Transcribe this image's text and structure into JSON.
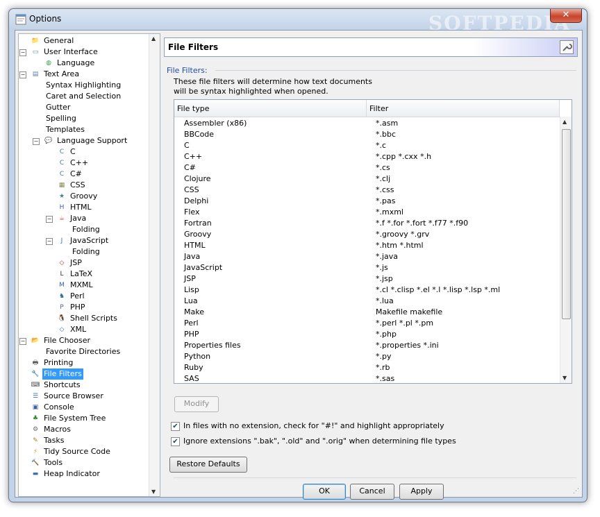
{
  "window": {
    "title": "Options",
    "close_symbol": "✕",
    "watermark": "SOFTPEDIA"
  },
  "tree": [
    {
      "label": "General",
      "level": 1,
      "icon": "folder-icon",
      "glyph": "📁",
      "color": "#e6b94d",
      "expander": ""
    },
    {
      "label": "User Interface",
      "level": 1,
      "icon": "window-icon",
      "glyph": "▭",
      "color": "#5a7fb0",
      "expander": "−"
    },
    {
      "label": "Language",
      "level": 2,
      "icon": "globe-icon",
      "glyph": "◍",
      "color": "#3a9a4a",
      "expander": ""
    },
    {
      "label": "Text Area",
      "level": 1,
      "icon": "text-area-icon",
      "glyph": "▤",
      "color": "#5a7fb0",
      "expander": "−"
    },
    {
      "label": "Syntax Highlighting",
      "level": 2,
      "icon": "",
      "glyph": "",
      "color": "",
      "expander": ""
    },
    {
      "label": "Caret and Selection",
      "level": 2,
      "icon": "",
      "glyph": "",
      "color": "",
      "expander": ""
    },
    {
      "label": "Gutter",
      "level": 2,
      "icon": "",
      "glyph": "",
      "color": "",
      "expander": ""
    },
    {
      "label": "Spelling",
      "level": 2,
      "icon": "",
      "glyph": "",
      "color": "",
      "expander": ""
    },
    {
      "label": "Templates",
      "level": 2,
      "icon": "",
      "glyph": "",
      "color": "",
      "expander": ""
    },
    {
      "label": "Language Support",
      "level": 2,
      "icon": "speech-bubble-icon",
      "glyph": "💬",
      "color": "#5a7fb0",
      "expander": "−"
    },
    {
      "label": "C",
      "level": 3,
      "icon": "c-language-icon",
      "glyph": "C",
      "color": "#4b6fb5",
      "expander": ""
    },
    {
      "label": "C++",
      "level": 3,
      "icon": "cpp-language-icon",
      "glyph": "C",
      "color": "#4b6fb5",
      "expander": ""
    },
    {
      "label": "C#",
      "level": 3,
      "icon": "csharp-language-icon",
      "glyph": "C",
      "color": "#4b6fb5",
      "expander": ""
    },
    {
      "label": "CSS",
      "level": 3,
      "icon": "css-icon",
      "glyph": "▦",
      "color": "#8a8a5a",
      "expander": ""
    },
    {
      "label": "Groovy",
      "level": 3,
      "icon": "groovy-icon",
      "glyph": "★",
      "color": "#4a7a9a",
      "expander": ""
    },
    {
      "label": "HTML",
      "level": 3,
      "icon": "html-icon",
      "glyph": "H",
      "color": "#3a5fa0",
      "expander": ""
    },
    {
      "label": "Java",
      "level": 3,
      "icon": "java-cup-icon",
      "glyph": "☕",
      "color": "#b35a2a",
      "expander": "−"
    },
    {
      "label": "Folding",
      "level": 4,
      "icon": "",
      "glyph": "",
      "color": "",
      "expander": ""
    },
    {
      "label": "JavaScript",
      "level": 3,
      "icon": "javascript-icon",
      "glyph": "J",
      "color": "#3a70c0",
      "expander": "−"
    },
    {
      "label": "Folding",
      "level": 4,
      "icon": "",
      "glyph": "",
      "color": "",
      "expander": ""
    },
    {
      "label": "JSP",
      "level": 3,
      "icon": "jsp-icon",
      "glyph": "◇",
      "color": "#c03030",
      "expander": ""
    },
    {
      "label": "LaTeX",
      "level": 3,
      "icon": "latex-icon",
      "glyph": "L",
      "color": "#333333",
      "expander": ""
    },
    {
      "label": "MXML",
      "level": 3,
      "icon": "mxml-icon",
      "glyph": "M",
      "color": "#3a5fa0",
      "expander": ""
    },
    {
      "label": "Perl",
      "level": 3,
      "icon": "perl-camel-icon",
      "glyph": "♞",
      "color": "#2a6a8a",
      "expander": ""
    },
    {
      "label": "PHP",
      "level": 3,
      "icon": "php-icon",
      "glyph": "P",
      "color": "#5b5fa0",
      "expander": ""
    },
    {
      "label": "Shell Scripts",
      "level": 3,
      "icon": "penguin-icon",
      "glyph": "🐧",
      "color": "#222222",
      "expander": ""
    },
    {
      "label": "XML",
      "level": 3,
      "icon": "xml-icon",
      "glyph": "◇",
      "color": "#3a70c0",
      "expander": ""
    },
    {
      "label": "File Chooser",
      "level": 1,
      "icon": "folder-open-icon",
      "glyph": "📂",
      "color": "#e6b94d",
      "expander": "−"
    },
    {
      "label": "Favorite Directories",
      "level": 2,
      "icon": "",
      "glyph": "",
      "color": "",
      "expander": ""
    },
    {
      "label": "Printing",
      "level": 1,
      "icon": "printer-icon",
      "glyph": "🖶",
      "color": "#555555",
      "expander": ""
    },
    {
      "label": "File Filters",
      "level": 1,
      "icon": "wrench-icon",
      "glyph": "🔧",
      "color": "#777777",
      "expander": "",
      "selected": true
    },
    {
      "label": "Shortcuts",
      "level": 1,
      "icon": "keyboard-icon",
      "glyph": "⌨",
      "color": "#555555",
      "expander": ""
    },
    {
      "label": "Source Browser",
      "level": 1,
      "icon": "list-icon",
      "glyph": "☰",
      "color": "#3a70c0",
      "expander": ""
    },
    {
      "label": "Console",
      "level": 1,
      "icon": "monitor-icon",
      "glyph": "▣",
      "color": "#3a5fa0",
      "expander": ""
    },
    {
      "label": "File System Tree",
      "level": 1,
      "icon": "tree-icon",
      "glyph": "♣",
      "color": "#2a8a2a",
      "expander": ""
    },
    {
      "label": "Macros",
      "level": 1,
      "icon": "gear-icon",
      "glyph": "⚙",
      "color": "#666666",
      "expander": ""
    },
    {
      "label": "Tasks",
      "level": 1,
      "icon": "pencil-icon",
      "glyph": "✎",
      "color": "#b07a20",
      "expander": ""
    },
    {
      "label": "Tidy Source Code",
      "level": 1,
      "icon": "lightning-icon",
      "glyph": "⚡",
      "color": "#d0a020",
      "expander": ""
    },
    {
      "label": "Tools",
      "level": 1,
      "icon": "tools-icon",
      "glyph": "🔨",
      "color": "#777777",
      "expander": ""
    },
    {
      "label": "Heap Indicator",
      "level": 1,
      "icon": "memory-icon",
      "glyph": "▬",
      "color": "#3a70c0",
      "expander": ""
    }
  ],
  "panel": {
    "title": "File Filters",
    "group_label": "File Filters:",
    "description_line1": "These file filters will determine how text documents",
    "description_line2": "will be syntax highlighted when opened."
  },
  "table": {
    "columns": [
      "File type",
      "Filter"
    ],
    "rows": [
      [
        "Assembler (x86)",
        "*.asm"
      ],
      [
        "BBCode",
        "*.bbc"
      ],
      [
        "C",
        "*.c"
      ],
      [
        "C++",
        "*.cpp *.cxx *.h"
      ],
      [
        "C#",
        "*.cs"
      ],
      [
        "Clojure",
        "*.clj"
      ],
      [
        "CSS",
        "*.css"
      ],
      [
        "Delphi",
        "*.pas"
      ],
      [
        "Flex",
        "*.mxml"
      ],
      [
        "Fortran",
        "*.f *.for *.fort *.f77 *.f90"
      ],
      [
        "Groovy",
        "*.groovy *.grv"
      ],
      [
        "HTML",
        "*.htm *.html"
      ],
      [
        "Java",
        "*.java"
      ],
      [
        "JavaScript",
        "*.js"
      ],
      [
        "JSP",
        "*.jsp"
      ],
      [
        "Lisp",
        "*.cl *.clisp *.el *.l *.lisp *.lsp *.ml"
      ],
      [
        "Lua",
        "*.lua"
      ],
      [
        "Make",
        "Makefile makefile"
      ],
      [
        "Perl",
        "*.perl *.pl *.pm"
      ],
      [
        "PHP",
        "*.php"
      ],
      [
        "Properties files",
        "*.properties *.ini"
      ],
      [
        "Python",
        "*.py"
      ],
      [
        "Ruby",
        "*.rb"
      ],
      [
        "SAS",
        "*.sas"
      ]
    ]
  },
  "buttons": {
    "modify": "Modify",
    "restore_defaults": "Restore Defaults",
    "ok": "OK",
    "cancel": "Cancel",
    "apply": "Apply"
  },
  "checkboxes": {
    "no_extension": {
      "label": "In files with no extension, check for \"#!\" and highlight appropriately",
      "checked": true
    },
    "ignore_extensions": {
      "label": "Ignore extensions \".bak\", \".old\" and \".orig\" when determining file types",
      "checked": true
    }
  },
  "colors": {
    "selection": "#3399ff",
    "group_label": "#1f4ba6",
    "title_bar": "#c4d3e8"
  }
}
